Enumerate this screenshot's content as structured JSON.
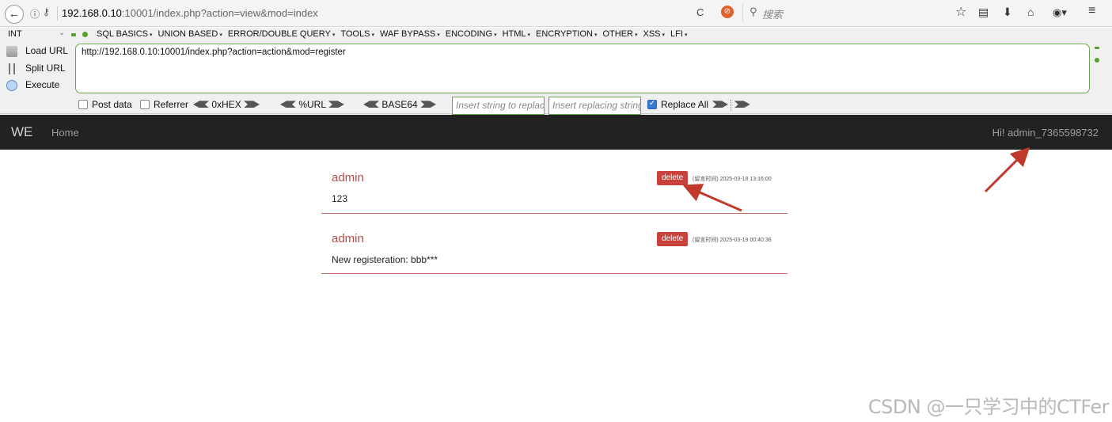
{
  "browser": {
    "url_host": "192.168.0.10",
    "url_rest": ":10001/index.php?action=view&mod=index",
    "search_placeholder": "搜索",
    "icons": [
      "back-icon",
      "info-icon",
      "key-icon",
      "reload-icon",
      "addon-icon",
      "search-icon",
      "star-icon",
      "reading-list-icon",
      "download-icon",
      "home-icon",
      "addon-menu-icon",
      "hamburger-menu-icon"
    ]
  },
  "hackbar": {
    "mode": "INT",
    "menu": [
      "SQL BASICS",
      "UNION BASED",
      "ERROR/DOUBLE QUERY",
      "TOOLS",
      "WAF BYPASS",
      "ENCODING",
      "HTML",
      "ENCRYPTION",
      "OTHER",
      "XSS",
      "LFI"
    ],
    "actions": [
      "Load URL",
      "Split URL",
      "Execute"
    ],
    "url_value": "http://192.168.0.10:10001/index.php?action=action&mod=register",
    "options": {
      "post_data": "Post data",
      "referrer": "Referrer",
      "hex": "0xHEX",
      "url": "%URL",
      "base64": "BASE64",
      "replace_placeholder": "Insert string to replace",
      "replacing_placeholder": "Insert replacing string",
      "replace_all": "Replace All",
      "replace_all_checked": true
    }
  },
  "site": {
    "brand": "WE",
    "nav_home": "Home",
    "greeting": "Hi! admin_7365598732"
  },
  "posts": [
    {
      "author": "admin",
      "body": "123",
      "delete_label": "delete",
      "time": "(留言时间) 2025-03-18 13:16:00"
    },
    {
      "author": "admin",
      "body": "New registeration: bbb***",
      "delete_label": "delete",
      "time": "(留言时间) 2025-03-19 00:40:36"
    }
  ],
  "watermark": "CSDN @一只学习中的CTFer",
  "colors": {
    "navbar": "#222222",
    "author": "#b94a48",
    "delete": "#c9413b",
    "annotation_arrow": "#c0392b",
    "hackbar_border": "#6aa84f"
  }
}
